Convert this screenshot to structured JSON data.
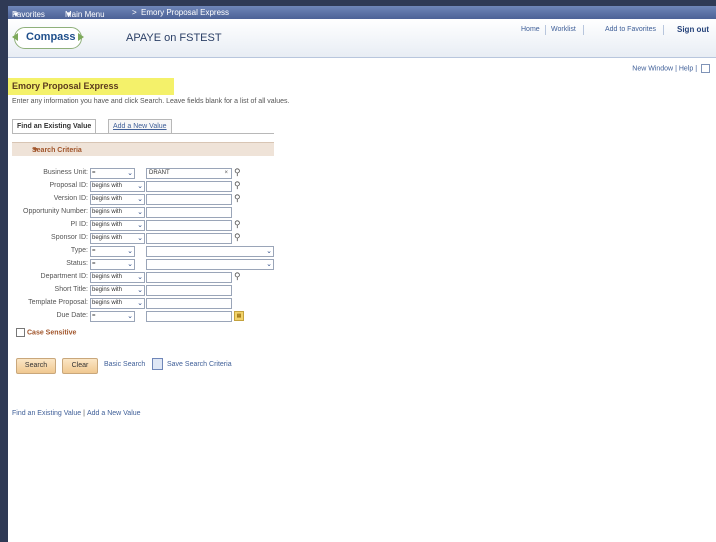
{
  "topnav": {
    "favorites": "Favorites",
    "main_menu": "Main Menu",
    "breadcrumb_sep": ">",
    "breadcrumb_current": "Emory Proposal Express"
  },
  "header": {
    "logo_text": "Compass",
    "app_title": "APAYE on FSTEST",
    "links": [
      "Home",
      "Worklist",
      "Add to Favorites"
    ],
    "signout": "Sign out"
  },
  "utility": {
    "new_window": "New Window",
    "help": "Help"
  },
  "page": {
    "title": "Emory Proposal Express",
    "instructions": "Enter any information you have and click Search. Leave fields blank for a list of all values."
  },
  "tabs": {
    "find": "Find an Existing Value",
    "add": "Add a New Value"
  },
  "criteria": {
    "header": "Search Criteria",
    "fields": [
      {
        "label": "Business Unit:",
        "operator": "=",
        "value": "DRANT"
      },
      {
        "label": "Proposal ID:",
        "operator": "begins with",
        "value": ""
      },
      {
        "label": "Version ID:",
        "operator": "begins with",
        "value": ""
      },
      {
        "label": "Opportunity Number:",
        "operator": "begins with",
        "value": ""
      },
      {
        "label": "PI ID:",
        "operator": "begins with",
        "value": ""
      },
      {
        "label": "Sponsor ID:",
        "operator": "begins with",
        "value": ""
      },
      {
        "label": "Type:",
        "operator": "=",
        "value": ""
      },
      {
        "label": "Status:",
        "operator": "=",
        "value": ""
      },
      {
        "label": "Department ID:",
        "operator": "begins with",
        "value": ""
      },
      {
        "label": "Short Title:",
        "operator": "begins with",
        "value": ""
      },
      {
        "label": "Template Proposal:",
        "operator": "begins with",
        "value": ""
      },
      {
        "label": "Due Date:",
        "operator": "=",
        "value": ""
      }
    ],
    "case_sensitive": "Case Sensitive"
  },
  "actions": {
    "search": "Search",
    "clear": "Clear",
    "basic_search": "Basic Search",
    "save_criteria": "Save Search Criteria"
  },
  "footer": {
    "find": "Find an Existing Value",
    "add": "Add a New Value"
  },
  "colors": {
    "title_highlight": "#f4f16a",
    "nav_blue": "#4c6296",
    "criteria_header_bg": "#efe3d8",
    "button_fill": "#f0c890"
  }
}
